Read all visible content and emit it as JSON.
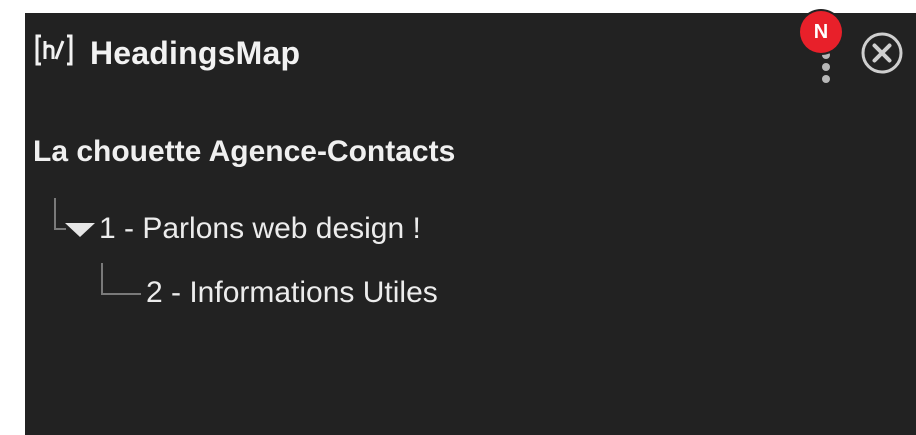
{
  "header": {
    "app_title": "HeadingsMap",
    "logo_icon": "h-slash-logo-icon",
    "menu_icon": "vertical-dots-menu-icon",
    "notification_badge": "N",
    "notification_color": "#e8202a",
    "close_icon": "close-circle-icon"
  },
  "outline": {
    "page_title": "La chouette Agence-Contacts",
    "headings": [
      {
        "level": 1,
        "text": "1 - Parlons web design !",
        "expanded": true
      },
      {
        "level": 2,
        "text": "2 - Informations Utiles"
      }
    ]
  },
  "colors": {
    "panel_background": "#222222",
    "text": "#ececec",
    "tree_lines": "#7a7a7a"
  }
}
